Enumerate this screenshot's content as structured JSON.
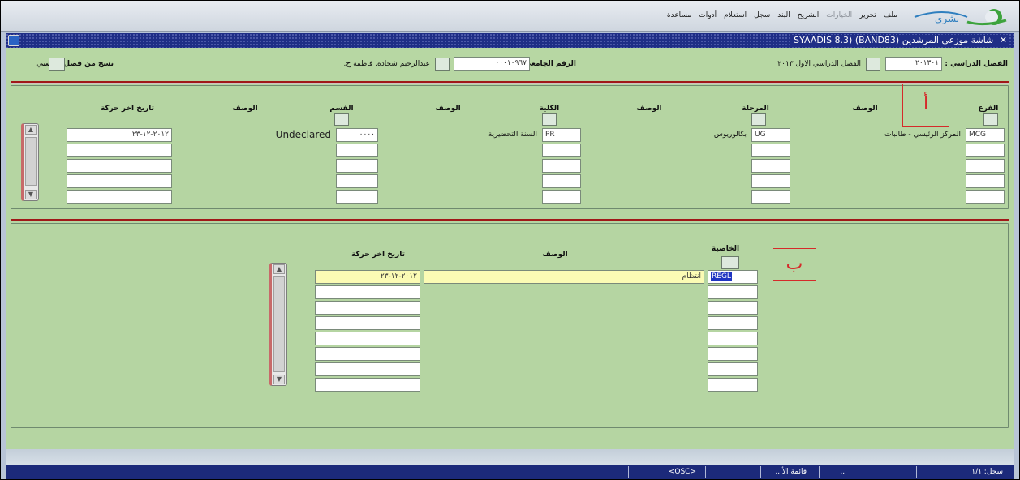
{
  "menu": {
    "items": [
      "ملف",
      "تحرير",
      "الخيارات",
      "الشريح",
      "البند",
      "سجل",
      "استعلام",
      "أدوات",
      "مساعدة"
    ],
    "dimmed": [
      false,
      false,
      true,
      false,
      false,
      false,
      false,
      false,
      false
    ]
  },
  "logo": {
    "text": "بشرى"
  },
  "window": {
    "title": "شاشة موزعي المرشدين (BAND83) (SYAADIS 8.3",
    "close_glyph": "✕"
  },
  "header": {
    "term_label": "الفصل الدراسي :",
    "term_value": "٢٠١٣٠١",
    "term_desc": "الفصل الدراسي الاول ٢٠١٣",
    "id_label": "الرقم الجامعي:",
    "id_value": "٠٠٠١٠٩٦٧",
    "student_name": "عبدالرحيم شحاده, فاطمة ح.",
    "copy_label": "نسخ من فصل دراسي"
  },
  "upper": {
    "headers": {
      "branch": "الفرع",
      "desc1": "الوصف",
      "level": "المرحلة",
      "desc2": "الوصف",
      "college": "الكلية",
      "desc3": "الوصف",
      "dept": "القسم",
      "desc4": "الوصف",
      "last_activity": "تاريخ اخر حركة"
    },
    "row": {
      "branch": "MCG",
      "branch_desc": "المركز الرئيسي - طالبات",
      "level": "UG",
      "level_desc": "بكالوريوس",
      "college": "PR",
      "college_desc": "السنة التحضيرية",
      "dept": "٠٠٠٠",
      "dept_desc": "Undeclared",
      "date": "٢٠١٢-١٢-٢٣"
    },
    "callout": "أ"
  },
  "lower": {
    "headers": {
      "attribute": "الخاصية",
      "desc": "الوصف",
      "last_activity": "تاريخ اخر حركة"
    },
    "row": {
      "attribute": "REGL",
      "attribute_desc": "انتظام",
      "date": "٢٠١٢-١٢-٢٣"
    },
    "callout": "ب"
  },
  "status": {
    "record": "سجل: ١/١",
    "list": "...",
    "list_value": "قائمة الأ...",
    "osc": "<OSC>"
  },
  "colors": {
    "form_bg": "#b5d5a2",
    "title_bg": "#1f2e86",
    "divider": "#a01818",
    "callout": "#d52a2a",
    "current_field": "#fbfbb4"
  }
}
